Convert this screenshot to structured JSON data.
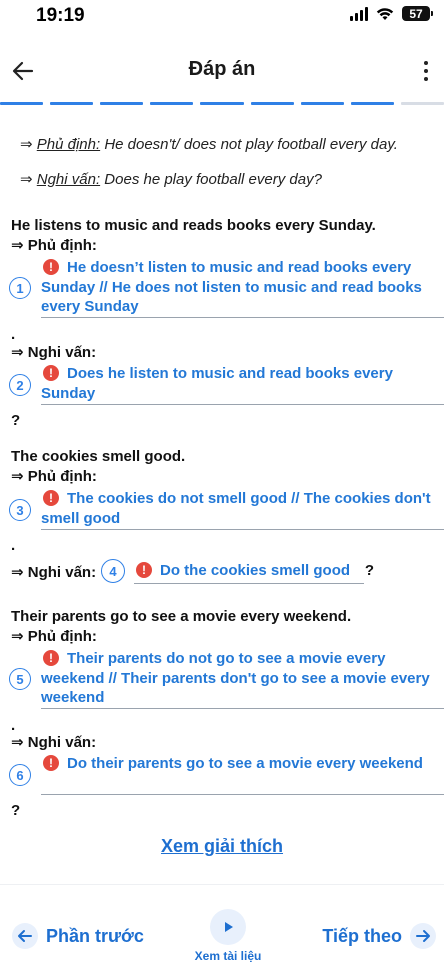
{
  "status_bar": {
    "time": "19:19",
    "battery": "57"
  },
  "header": {
    "title": "Đáp án"
  },
  "progress": {
    "completed": 8,
    "total": 9
  },
  "example": {
    "negative_label": "Phủ định:",
    "negative_text": "He doesn't/ does not play football every day.",
    "question_label": "Nghi vấn:",
    "question_text": "Does he play football every day?",
    "arrow": "⇒"
  },
  "labels": {
    "negative": "⇒ Phủ định:",
    "question": "⇒ Nghi vấn:",
    "period": ".",
    "qmark": "?"
  },
  "questions": [
    {
      "sentence": "He listens to music and reads books every Sunday.",
      "answers": [
        {
          "num": "1",
          "text": "He doesn’t listen to music and read books every Sunday // He does not listen to music and read books every Sunday"
        },
        {
          "num": "2",
          "text": "Does he listen to music and read books every Sunday"
        }
      ]
    },
    {
      "sentence": "The cookies smell good.",
      "answers": [
        {
          "num": "3",
          "text": "The cookies do not smell good // The cookies don't smell good"
        },
        {
          "num": "4",
          "text": "Do the cookies smell good"
        }
      ]
    },
    {
      "sentence": "Their parents go to see a movie every weekend.",
      "answers": [
        {
          "num": "5",
          "text": "Their parents do not go to see a movie every weekend // Their parents don't go to see a movie every weekend"
        },
        {
          "num": "6",
          "text": "Do their parents go to see a movie every weekend"
        }
      ]
    }
  ],
  "explain_link": "Xem giải thích",
  "bottom_nav": {
    "prev": "Phần trước",
    "docs": "Xem tài liệu",
    "next": "Tiếp theo"
  },
  "icons": {
    "error": "!",
    "back": "arrow-left-icon",
    "more": "more-vertical-icon",
    "play": "play-icon"
  },
  "colors": {
    "accent": "#2f80e6",
    "answer": "#2378d6",
    "error": "#e5483c"
  }
}
